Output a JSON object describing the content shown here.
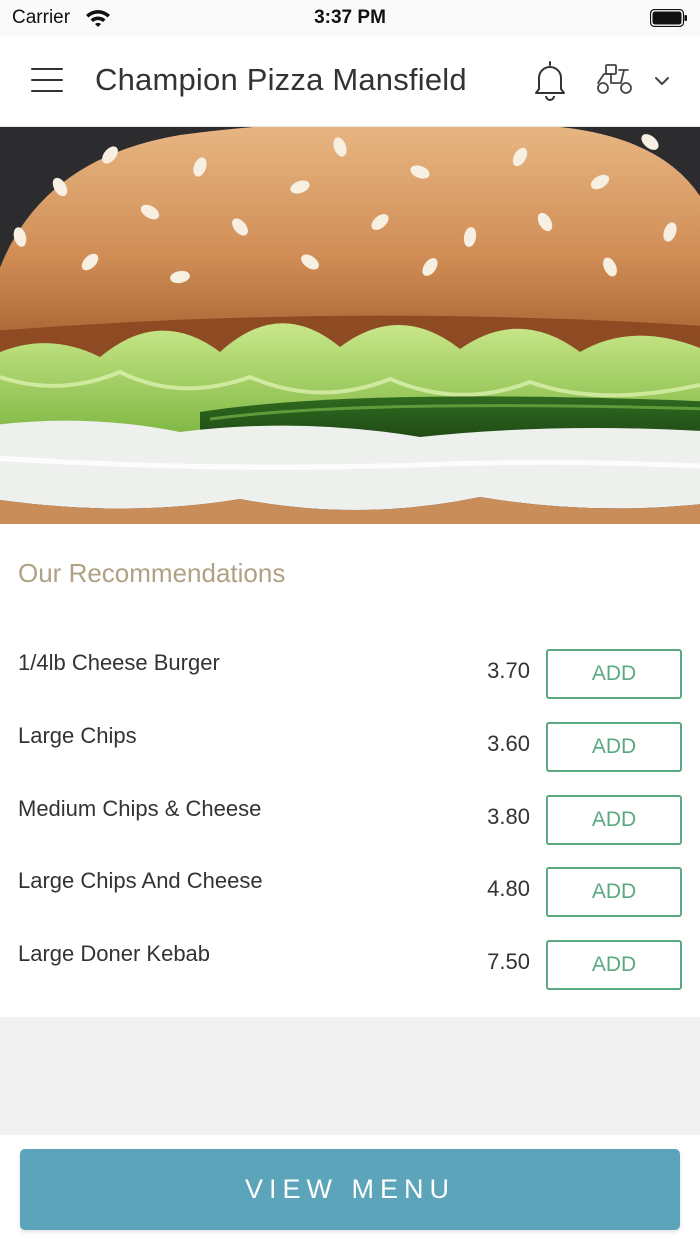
{
  "status_bar": {
    "carrier": "Carrier",
    "time": "3:37 PM",
    "icons": [
      "wifi-icon",
      "battery-icon"
    ]
  },
  "header": {
    "title": "Champion Pizza Mansfield",
    "icons": [
      "menu-icon",
      "bell-icon",
      "scooter-icon",
      "chevron-down-icon"
    ]
  },
  "hero": {
    "icon": "burger-image"
  },
  "recommendations": {
    "title": "Our Recommendations",
    "add_label": "ADD",
    "items": [
      {
        "name": "1/4lb Cheese Burger",
        "price": "3.70"
      },
      {
        "name": "Large Chips",
        "price": "3.60"
      },
      {
        "name": "Medium Chips & Cheese",
        "price": "3.80"
      },
      {
        "name": "Large Chips And Cheese",
        "price": "4.80"
      },
      {
        "name": "Large Doner Kebab",
        "price": "7.50"
      }
    ]
  },
  "footer": {
    "view_menu_label": "VIEW MENU"
  },
  "colors": {
    "accent_green": "#5aa980",
    "heading_tan": "#b0a184",
    "button_blue": "#5ba4b9"
  }
}
